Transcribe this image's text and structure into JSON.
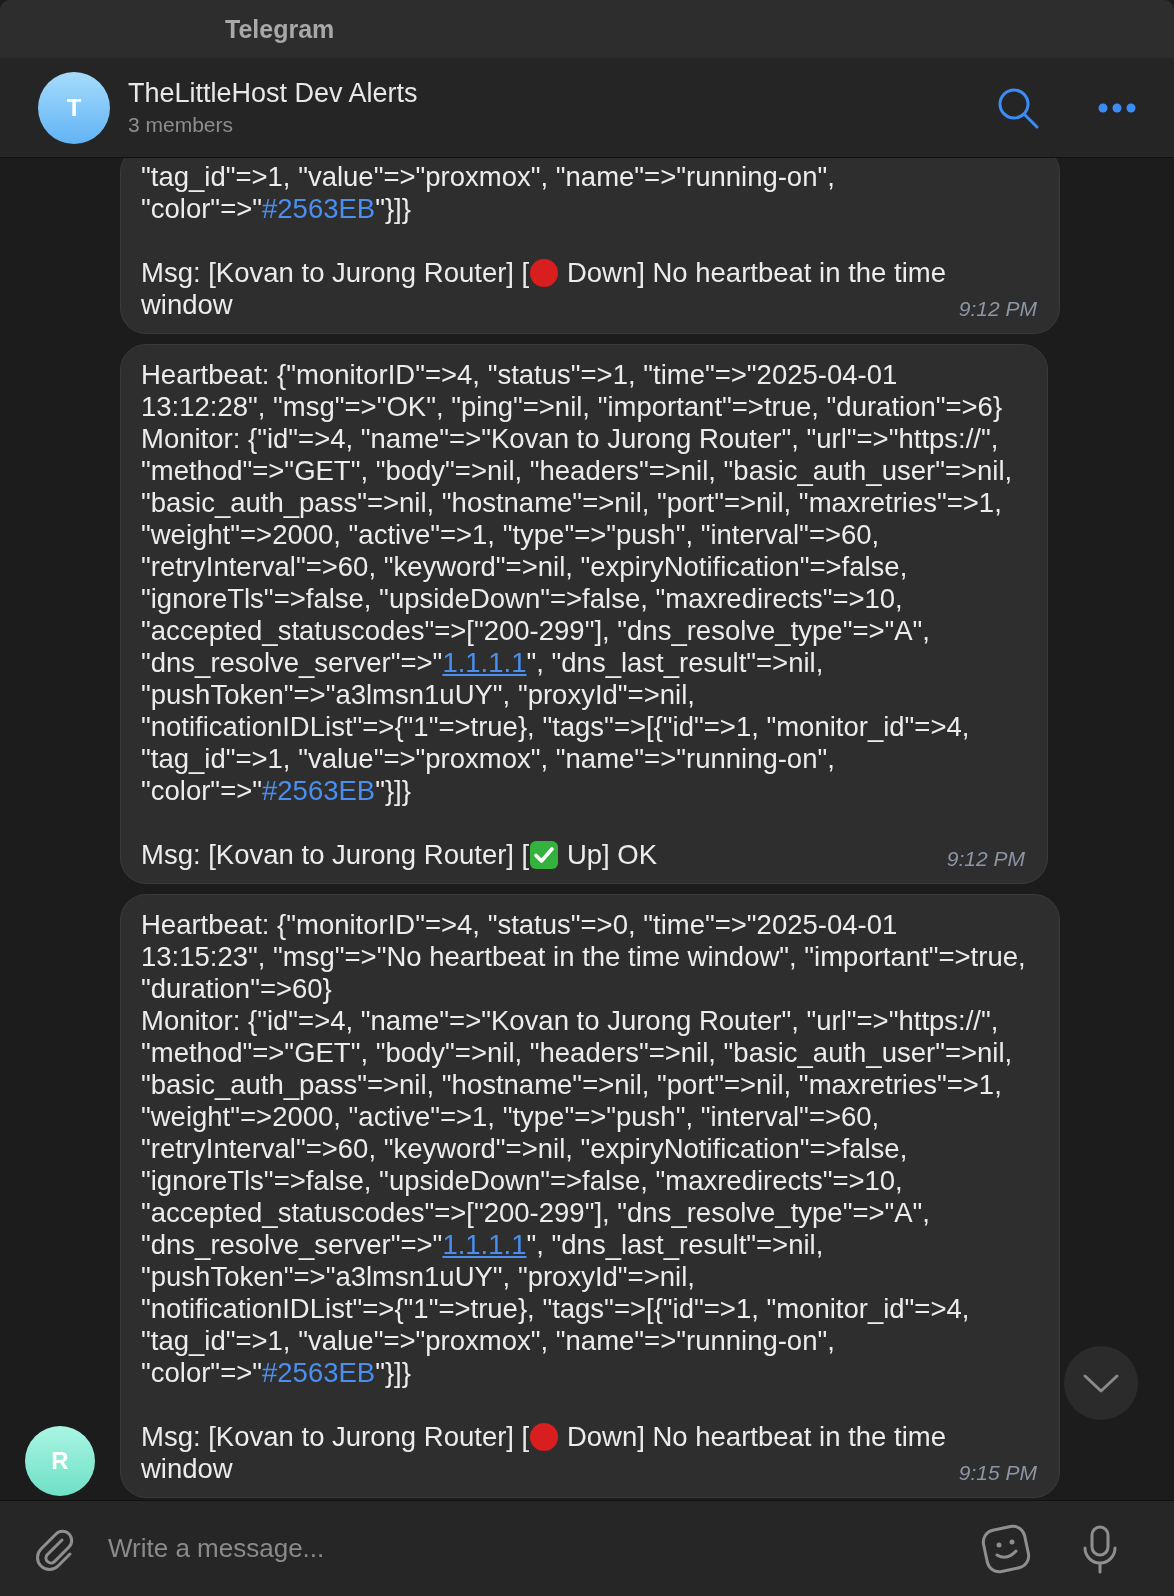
{
  "window": {
    "title": "Telegram"
  },
  "chat": {
    "name": "TheLittleHost Dev Alerts",
    "members": "3 members",
    "avatar_letter": "T"
  },
  "messages": [
    {
      "time": "9:12 PM",
      "paragraphs": [
        [
          [
            {
              "kind": "text",
              "text": "\"tag_id\"=>1, \"value\"=>\"proxmox\", \"name\"=>\"running-on\","
            }
          ],
          [
            {
              "kind": "text",
              "text": "\"color\"=>\""
            },
            {
              "kind": "hashtag",
              "text": "#2563EB"
            },
            {
              "kind": "text",
              "text": "\"}]}"
            }
          ]
        ],
        [
          [
            {
              "kind": "text",
              "text": "Msg: [Kovan to Jurong Router] ["
            },
            {
              "kind": "red-dot-icon"
            },
            {
              "kind": "text",
              "text": " Down] No heartbeat in the time"
            }
          ],
          [
            {
              "kind": "text",
              "text": "window"
            }
          ]
        ]
      ]
    },
    {
      "time": "9:12 PM",
      "paragraphs": [
        [
          [
            {
              "kind": "text",
              "text": "Heartbeat: {\"monitorID\"=>4, \"status\"=>1, \"time\"=>\"2025-04-01"
            }
          ],
          [
            {
              "kind": "text",
              "text": "13:12:28\", \"msg\"=>\"OK\", \"ping\"=>nil, \"important\"=>true, \"duration\"=>6}"
            }
          ],
          [
            {
              "kind": "text",
              "text": "Monitor: {\"id\"=>4, \"name\"=>\"Kovan to Jurong Router\", \"url\"=>\"https://\","
            }
          ],
          [
            {
              "kind": "text",
              "text": "\"method\"=>\"GET\", \"body\"=>nil, \"headers\"=>nil, \"basic_auth_user\"=>nil,"
            }
          ],
          [
            {
              "kind": "text",
              "text": "\"basic_auth_pass\"=>nil, \"hostname\"=>nil, \"port\"=>nil, \"maxretries\"=>1,"
            }
          ],
          [
            {
              "kind": "text",
              "text": "\"weight\"=>2000, \"active\"=>1, \"type\"=>\"push\", \"interval\"=>60,"
            }
          ],
          [
            {
              "kind": "text",
              "text": "\"retryInterval\"=>60, \"keyword\"=>nil, \"expiryNotification\"=>false,"
            }
          ],
          [
            {
              "kind": "text",
              "text": "\"ignoreTls\"=>false, \"upsideDown\"=>false, \"maxredirects\"=>10,"
            }
          ],
          [
            {
              "kind": "text",
              "text": "\"accepted_statuscodes\"=>[\"200-299\"], \"dns_resolve_type\"=>\"A\","
            }
          ],
          [
            {
              "kind": "text",
              "text": "\"dns_resolve_server\"=>\""
            },
            {
              "kind": "link",
              "text": "1.1.1.1"
            },
            {
              "kind": "text",
              "text": "\", \"dns_last_result\"=>nil,"
            }
          ],
          [
            {
              "kind": "text",
              "text": "\"pushToken\"=>\"a3lmsn1uUY\", \"proxyId\"=>nil,"
            }
          ],
          [
            {
              "kind": "text",
              "text": "\"notificationIDList\"=>{\"1\"=>true}, \"tags\"=>[{\"id\"=>1, \"monitor_id\"=>4,"
            }
          ],
          [
            {
              "kind": "text",
              "text": "\"tag_id\"=>1, \"value\"=>\"proxmox\", \"name\"=>\"running-on\","
            }
          ],
          [
            {
              "kind": "text",
              "text": "\"color\"=>\""
            },
            {
              "kind": "hashtag",
              "text": "#2563EB"
            },
            {
              "kind": "text",
              "text": "\"}]}"
            }
          ]
        ],
        [
          [
            {
              "kind": "text",
              "text": "Msg: [Kovan to Jurong Router] ["
            },
            {
              "kind": "check-icon"
            },
            {
              "kind": "text",
              "text": " Up] OK"
            }
          ]
        ]
      ]
    },
    {
      "time": "9:15 PM",
      "avatar_letter": "R",
      "paragraphs": [
        [
          [
            {
              "kind": "text",
              "text": "Heartbeat: {\"monitorID\"=>4, \"status\"=>0, \"time\"=>\"2025-04-01"
            }
          ],
          [
            {
              "kind": "text",
              "text": "13:15:23\", \"msg\"=>\"No heartbeat in the time window\", \"important\"=>true,"
            }
          ],
          [
            {
              "kind": "text",
              "text": "\"duration\"=>60}"
            }
          ],
          [
            {
              "kind": "text",
              "text": "Monitor: {\"id\"=>4, \"name\"=>\"Kovan to Jurong Router\", \"url\"=>\"https://\","
            }
          ],
          [
            {
              "kind": "text",
              "text": "\"method\"=>\"GET\", \"body\"=>nil, \"headers\"=>nil, \"basic_auth_user\"=>nil,"
            }
          ],
          [
            {
              "kind": "text",
              "text": "\"basic_auth_pass\"=>nil, \"hostname\"=>nil, \"port\"=>nil, \"maxretries\"=>1,"
            }
          ],
          [
            {
              "kind": "text",
              "text": "\"weight\"=>2000, \"active\"=>1, \"type\"=>\"push\", \"interval\"=>60,"
            }
          ],
          [
            {
              "kind": "text",
              "text": "\"retryInterval\"=>60, \"keyword\"=>nil, \"expiryNotification\"=>false,"
            }
          ],
          [
            {
              "kind": "text",
              "text": "\"ignoreTls\"=>false, \"upsideDown\"=>false, \"maxredirects\"=>10,"
            }
          ],
          [
            {
              "kind": "text",
              "text": "\"accepted_statuscodes\"=>[\"200-299\"], \"dns_resolve_type\"=>\"A\","
            }
          ],
          [
            {
              "kind": "text",
              "text": "\"dns_resolve_server\"=>\""
            },
            {
              "kind": "link",
              "text": "1.1.1.1"
            },
            {
              "kind": "text",
              "text": "\", \"dns_last_result\"=>nil,"
            }
          ],
          [
            {
              "kind": "text",
              "text": "\"pushToken\"=>\"a3lmsn1uUY\", \"proxyId\"=>nil,"
            }
          ],
          [
            {
              "kind": "text",
              "text": "\"notificationIDList\"=>{\"1\"=>true}, \"tags\"=>[{\"id\"=>1, \"monitor_id\"=>4,"
            }
          ],
          [
            {
              "kind": "text",
              "text": "\"tag_id\"=>1, \"value\"=>\"proxmox\", \"name\"=>\"running-on\","
            }
          ],
          [
            {
              "kind": "text",
              "text": "\"color\"=>\""
            },
            {
              "kind": "hashtag",
              "text": "#2563EB"
            },
            {
              "kind": "text",
              "text": "\"}]}"
            }
          ]
        ],
        [
          [
            {
              "kind": "text",
              "text": "Msg: [Kovan to Jurong Router] ["
            },
            {
              "kind": "red-dot-icon"
            },
            {
              "kind": "text",
              "text": " Down] No heartbeat in the time"
            }
          ],
          [
            {
              "kind": "text",
              "text": "window"
            }
          ]
        ]
      ]
    }
  ],
  "composer": {
    "placeholder": "Write a message..."
  }
}
